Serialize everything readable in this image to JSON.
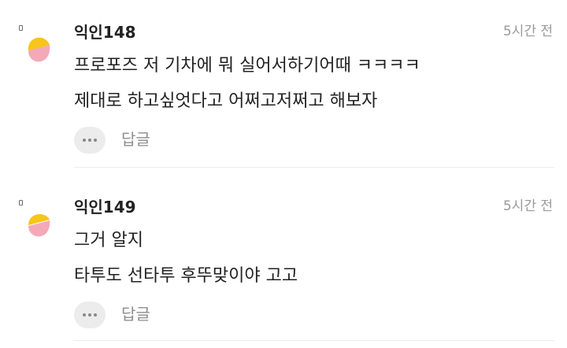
{
  "comments": [
    {
      "nickname": "익인148",
      "time": "5시간 전",
      "lines": [
        "프로포즈 저 기차에 뭐 실어서하기어때 ㅋㅋㅋㅋ",
        "제대로 하고싶엇다고 어쩌고저쩌고 해보자"
      ],
      "reply_label": "답글",
      "more_icon": "ellipsis-icon",
      "avatar_icon": "default-avatar-icon",
      "colors": {
        "avatar_top": "#f7c51c",
        "avatar_bottom": "#f4a9b8"
      }
    },
    {
      "nickname": "익인149",
      "time": "5시간 전",
      "lines": [
        "그거 알지",
        "타투도 선타투 후뚜맞이야 고고"
      ],
      "reply_label": "답글",
      "more_icon": "ellipsis-icon",
      "avatar_icon": "default-avatar-icon",
      "colors": {
        "avatar_top": "#f7c51c",
        "avatar_bottom": "#f4a9b8"
      }
    }
  ]
}
